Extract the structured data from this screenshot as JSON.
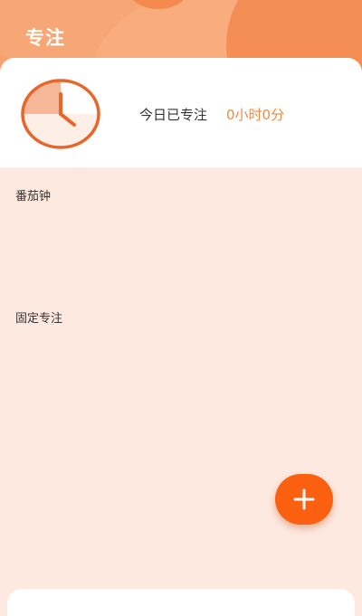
{
  "header": {
    "title": "专注"
  },
  "summary": {
    "today_label": "今日已专注",
    "today_value": "0小时0分"
  },
  "sections": {
    "pomodoro_label": "番茄钟",
    "fixed_label": "固定专注"
  },
  "fab": {
    "icon": "plus-icon"
  },
  "colors": {
    "header": "#f8a06e",
    "accent": "#fb6010",
    "clock": "#e8662a",
    "value_text": "#f08a3c",
    "background": "#fde9e0"
  }
}
